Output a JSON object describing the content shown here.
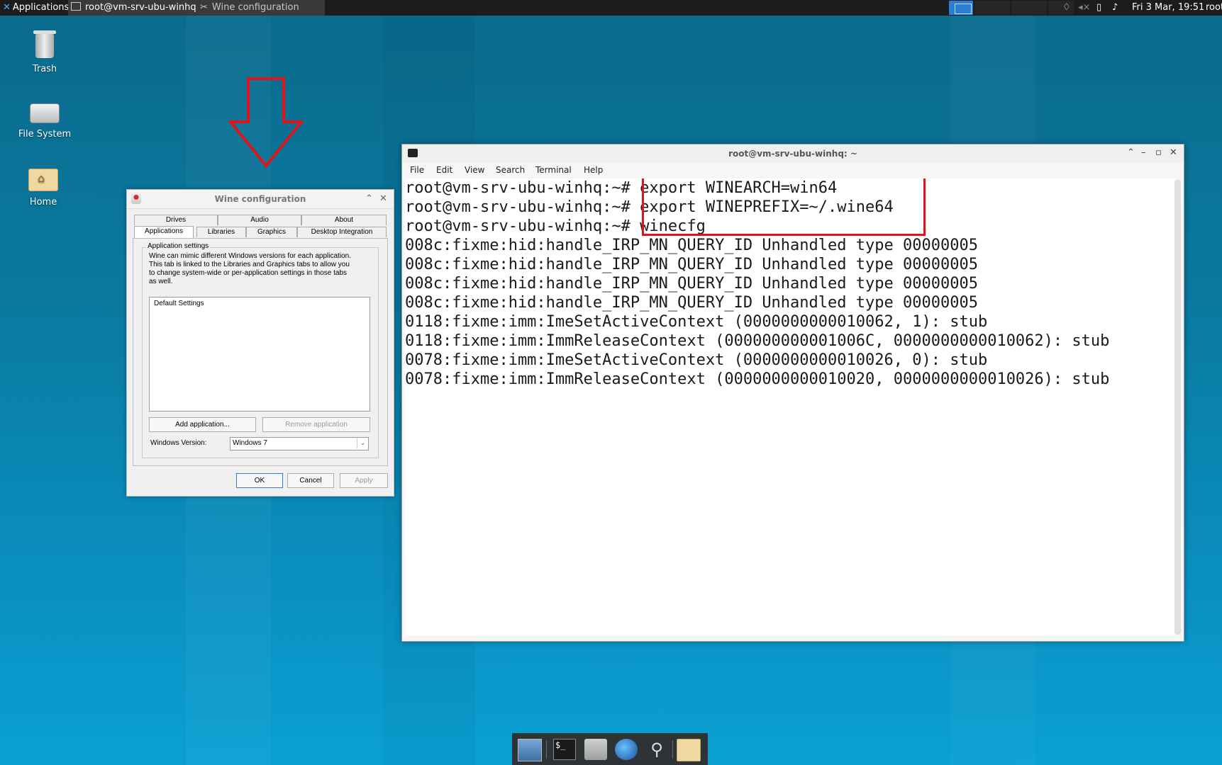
{
  "panel": {
    "apps_label": "Applications",
    "task1": "root@vm-srv-ubu-winhq...",
    "task2": "Wine configuration",
    "clock": "Fri  3 Mar, 19:51",
    "user": "root"
  },
  "desktop": {
    "icons": [
      "Trash",
      "File System",
      "Home"
    ]
  },
  "wine": {
    "title": "Wine configuration",
    "tabs_top": [
      "Drives",
      "Audio",
      "About"
    ],
    "tabs_bottom": [
      "Applications",
      "Libraries",
      "Graphics",
      "Desktop Integration"
    ],
    "group_title": "Application settings",
    "description": [
      "Wine can mimic different Windows versions for each application.",
      "This tab is linked to the Libraries and Graphics tabs to allow you",
      "to change system-wide or per-application settings in those tabs",
      "as well."
    ],
    "list_items": [
      "Default Settings"
    ],
    "add_button": "Add application...",
    "remove_button": "Remove application",
    "version_label": "Windows Version:",
    "version_value": "Windows 7",
    "ok": "OK",
    "cancel": "Cancel",
    "apply": "Apply"
  },
  "terminal": {
    "title": "root@vm-srv-ubu-winhq: ~",
    "menu": [
      "File",
      "Edit",
      "View",
      "Search",
      "Terminal",
      "Help"
    ],
    "lines": [
      "root@vm-srv-ubu-winhq:~# export WINEARCH=win64",
      "root@vm-srv-ubu-winhq:~# export WINEPREFIX=~/.wine64",
      "root@vm-srv-ubu-winhq:~# winecfg",
      "008c:fixme:hid:handle_IRP_MN_QUERY_ID Unhandled type 00000005",
      "008c:fixme:hid:handle_IRP_MN_QUERY_ID Unhandled type 00000005",
      "008c:fixme:hid:handle_IRP_MN_QUERY_ID Unhandled type 00000005",
      "008c:fixme:hid:handle_IRP_MN_QUERY_ID Unhandled type 00000005",
      "0118:fixme:imm:ImeSetActiveContext (0000000000010062, 1): stub",
      "0118:fixme:imm:ImmReleaseContext (000000000001006C, 0000000000010062): stub",
      "0078:fixme:imm:ImeSetActiveContext (0000000000010026, 0): stub",
      "0078:fixme:imm:ImmReleaseContext (0000000000010020, 0000000000010026): stub"
    ]
  },
  "colors": {
    "highlight": "#e0141c",
    "accent": "#2b7ed6"
  }
}
